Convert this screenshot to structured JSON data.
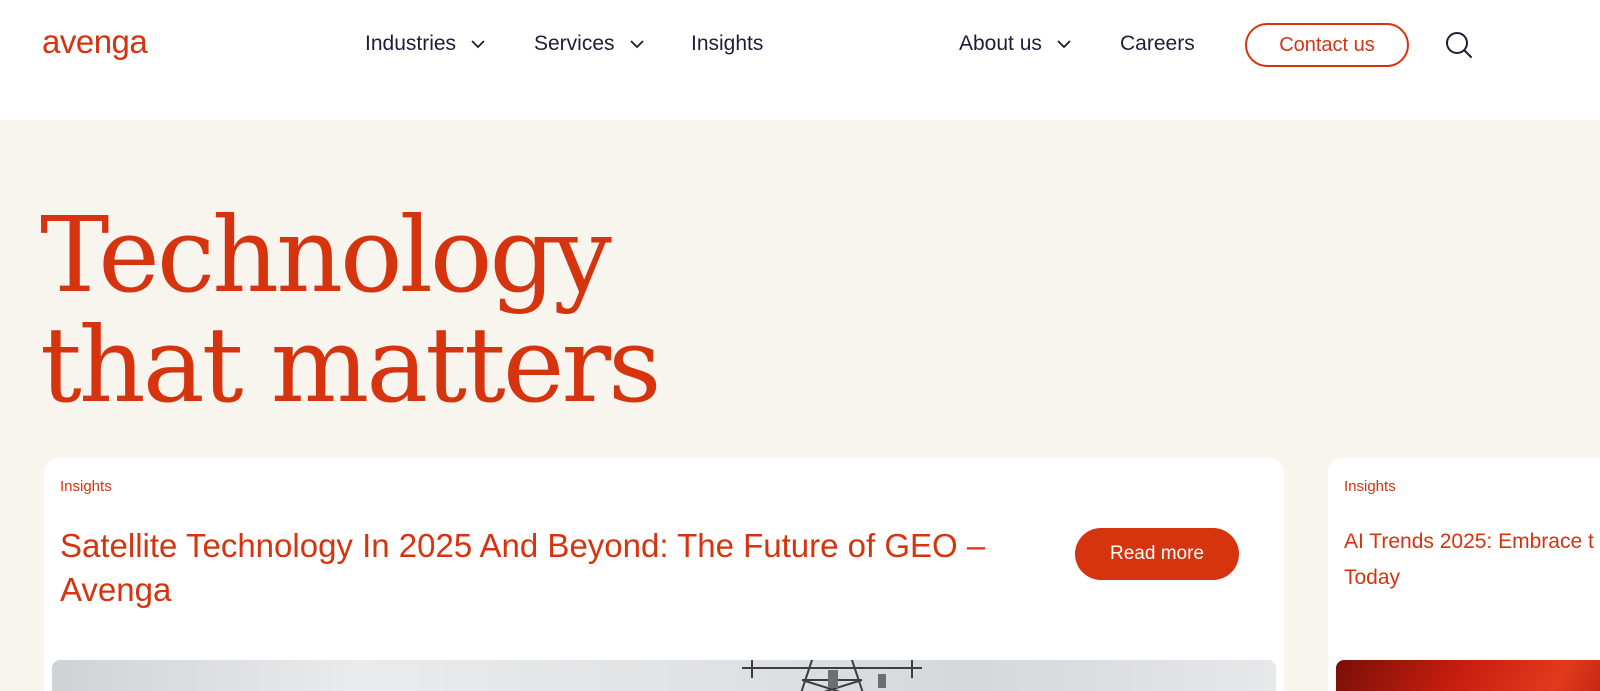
{
  "brand": {
    "logo_text": "avenga",
    "accent_color": "#d5340f",
    "text_color": "#1d1d3a",
    "hero_background": "#f8f4ee"
  },
  "nav": {
    "items": [
      {
        "label": "Industries",
        "has_dropdown": true
      },
      {
        "label": "Services",
        "has_dropdown": true
      },
      {
        "label": "Insights",
        "has_dropdown": false
      },
      {
        "label": "About us",
        "has_dropdown": true
      },
      {
        "label": "Careers",
        "has_dropdown": false
      }
    ],
    "contact_label": "Contact us",
    "search_icon": "search-icon"
  },
  "hero": {
    "title_line1": "Technology",
    "title_line2": "that matters"
  },
  "cards": [
    {
      "tag": "Insights",
      "title": "Satellite Technology In 2025 And Beyond: The Future of GEO – Avenga",
      "cta": "Read more"
    },
    {
      "tag": "Insights",
      "title_line1": "AI Trends 2025: Embrace t",
      "title_line2": "Today"
    }
  ]
}
